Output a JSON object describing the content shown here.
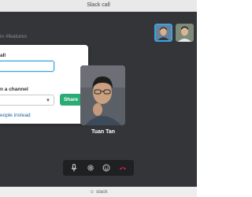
{
  "window": {
    "title": "Slack call"
  },
  "channel_hint": "in #features",
  "share_panel": {
    "section1_label": "all",
    "section2_label": "n a channel",
    "share_button": "Share",
    "link_text": "eople instead"
  },
  "participant": {
    "name": "Tuan Tan"
  },
  "footer": {
    "label": "slack"
  },
  "controls": [
    "microphone-icon",
    "settings-icon",
    "emoji-icon",
    "hangup-icon"
  ],
  "colors": {
    "accent": "#3aa3e3",
    "share": "#2bac76",
    "hangup": "#e01e5a"
  }
}
